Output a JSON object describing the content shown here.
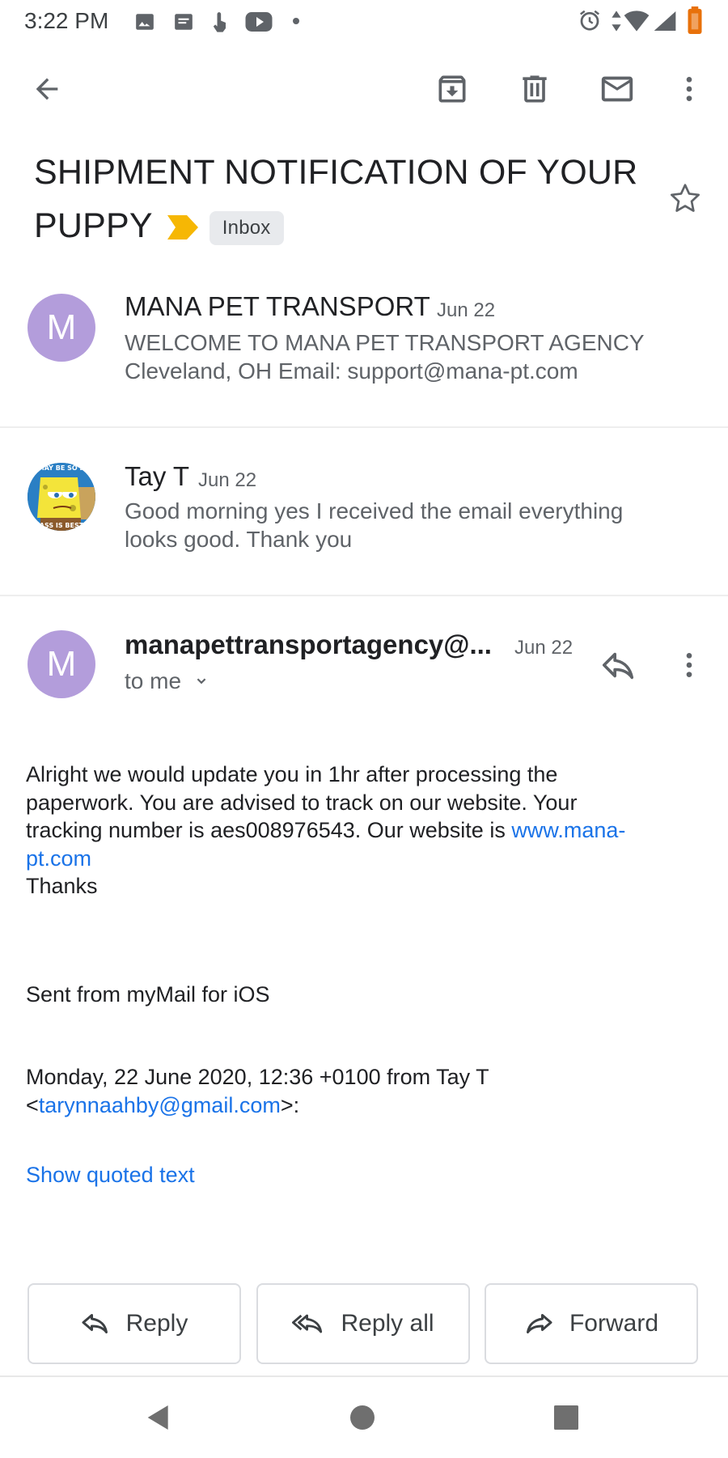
{
  "status_bar": {
    "time": "3:22 PM"
  },
  "toolbar": {
    "back_icon": "arrow-left-icon",
    "archive_icon": "archive-icon",
    "delete_icon": "trash-icon",
    "mark_unread_icon": "envelope-icon",
    "more_icon": "more-vert-icon"
  },
  "subject": {
    "line1": "SHIPMENT NOTIFICATION OF YOUR",
    "line2": "PUPPY",
    "label": "Inbox",
    "important_color": "#f6b704"
  },
  "messages": [
    {
      "avatar_letter": "M",
      "avatar_color": "#b39ddb",
      "sender": "MANA PET TRANSPORT",
      "date": "Jun 22",
      "snippet_line1": "WELCOME TO MANA PET TRANSPORT AGENCY",
      "snippet_line2": "Cleveland, OH Email: support@mana-pt.com"
    },
    {
      "avatar_image": "spongebob-meme-avatar",
      "avatar_text_top": "IT MAY BE SO BUT",
      "avatar_text_bottom": "ASS IS BEST",
      "sender": "Tay T",
      "date": "Jun 22",
      "snippet_line1": "Good morning yes I received the email everything",
      "snippet_line2": "looks good. Thank you"
    }
  ],
  "open_message": {
    "avatar_letter": "M",
    "sender": "manapettransportagency@...",
    "date": "Jun 22",
    "recipient": "to me",
    "body_line1": "Alright we would update you in 1hr after processing the",
    "body_line2": "paperwork. You are advised to track on our website. Your",
    "body_line3_text": "tracking number is aes008976543. Our website is ",
    "body_link_part1": "www.mana-",
    "body_link_part2": "pt.com",
    "thanks": "Thanks",
    "signature": "Sent from myMail for iOS",
    "quote_header_line1": "Monday, 22 June 2020, 12:36 +0100 from Tay T",
    "quote_lt": "<",
    "quote_email": "tarynnaahby@gmail.com",
    "quote_gt": ">:",
    "show_quoted": "Show quoted text"
  },
  "actions": {
    "reply": "Reply",
    "reply_all": "Reply all",
    "forward": "Forward"
  },
  "colors": {
    "link": "#1a73e8",
    "avatar": "#b39ddb"
  }
}
